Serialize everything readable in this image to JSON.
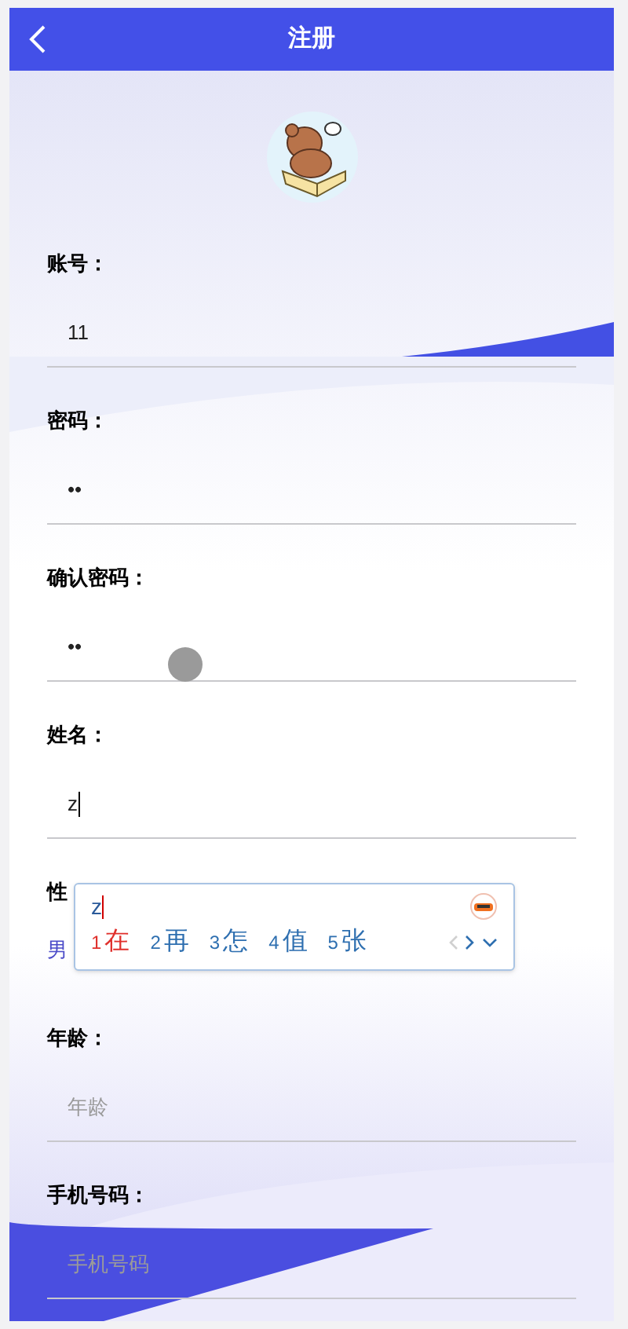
{
  "header": {
    "title": "注册"
  },
  "fields": [
    {
      "label": "账号：",
      "kind": "input",
      "value": "11"
    },
    {
      "label": "密码：",
      "kind": "input",
      "value": "••"
    },
    {
      "label": "确认密码：",
      "kind": "input",
      "value": "••"
    },
    {
      "label": "姓名：",
      "kind": "input",
      "value": "z",
      "focused": true
    },
    {
      "label": "性",
      "kind": "radio",
      "options": [
        {
          "label": "男"
        }
      ]
    },
    {
      "label": "年龄：",
      "kind": "input",
      "placeholder": "年龄"
    },
    {
      "label": "手机号码：",
      "kind": "input",
      "placeholder": "手机号码"
    }
  ],
  "ime": {
    "composition": "z",
    "candidates": [
      {
        "number": "1",
        "text": "在",
        "selected": true
      },
      {
        "number": "2",
        "text": "再",
        "selected": false
      },
      {
        "number": "3",
        "text": "怎",
        "selected": false
      },
      {
        "number": "4",
        "text": "值",
        "selected": false
      },
      {
        "number": "5",
        "text": "张",
        "selected": false
      }
    ],
    "prev_disabled": true
  }
}
